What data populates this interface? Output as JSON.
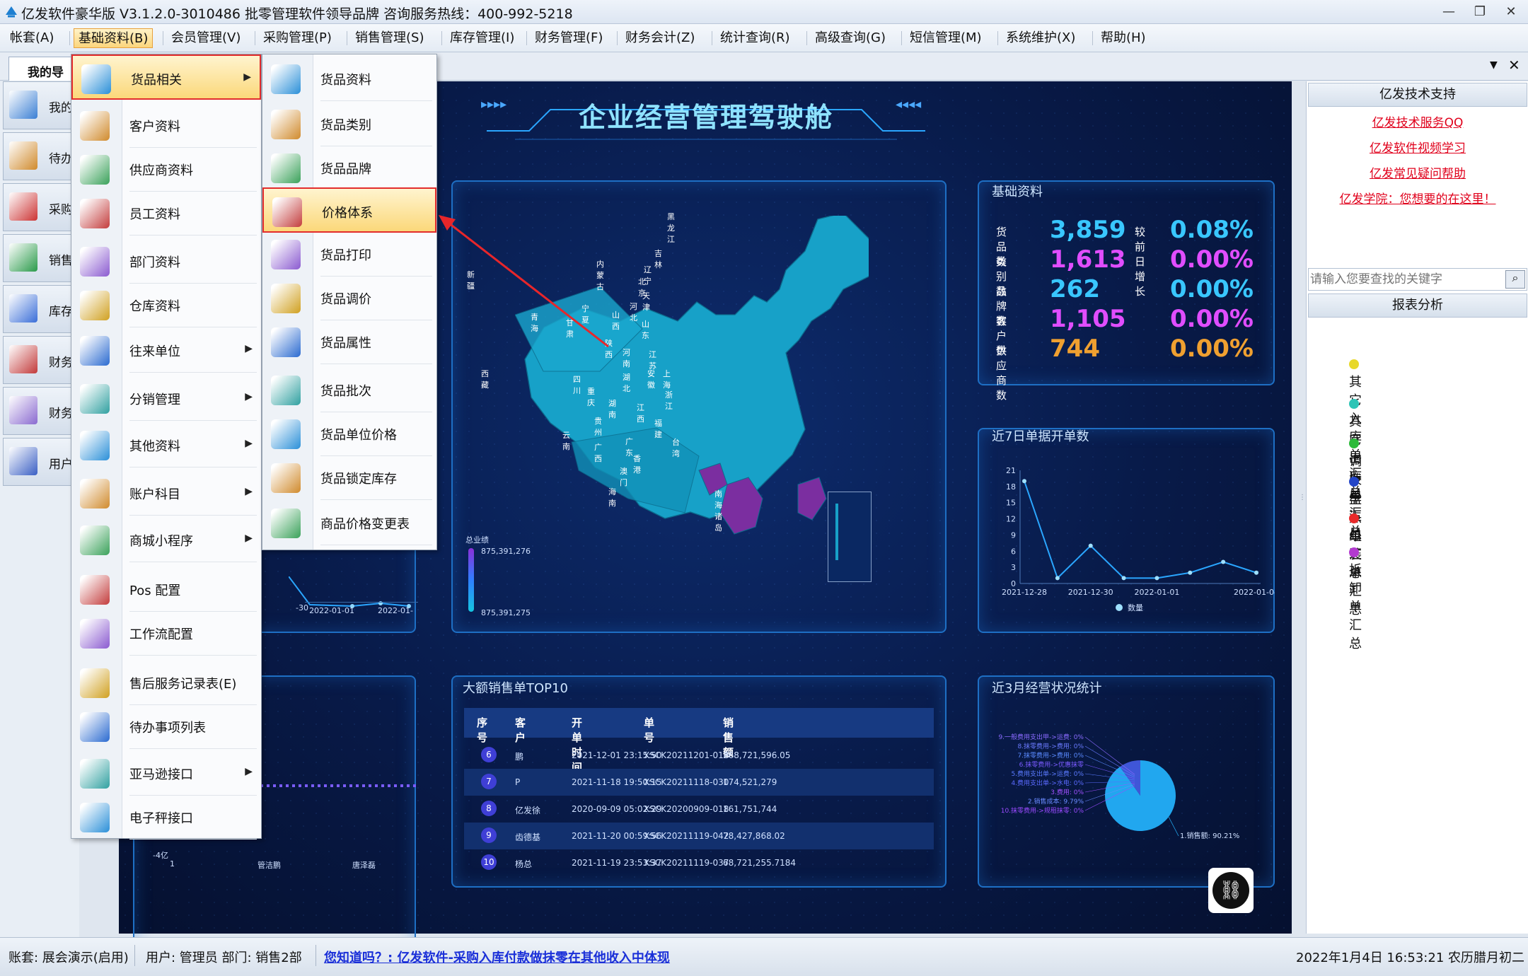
{
  "window": {
    "title": "亿发软件豪华版 V3.1.2.0-3010486 批零管理软件领导品牌 咨询服务热线：400-992-5218"
  },
  "menubar": [
    "帐套(A)",
    "基础资料(B)",
    "会员管理(V)",
    "采购管理(P)",
    "销售管理(S)",
    "库存管理(I)",
    "财务管理(F)",
    "财务会计(Z)",
    "统计查询(R)",
    "高级查询(G)",
    "短信管理(M)",
    "系统维护(X)",
    "帮助(H)"
  ],
  "tab": {
    "label": "我的导"
  },
  "leftnav": [
    "我的",
    "待办",
    "采购",
    "销售",
    "库存",
    "财务",
    "财务",
    "用户"
  ],
  "main_menu": {
    "items": [
      {
        "label": "货品相关",
        "arrow": true
      },
      {
        "label": "客户资料"
      },
      {
        "label": "供应商资料"
      },
      {
        "label": "员工资料"
      },
      {
        "label": "部门资料"
      },
      {
        "label": "仓库资料"
      },
      {
        "label": "往来单位",
        "arrow": true
      },
      {
        "label": "分销管理",
        "arrow": true
      },
      {
        "label": "其他资料",
        "arrow": true
      },
      {
        "label": "账户科目",
        "arrow": true
      },
      {
        "label": "商城小程序",
        "arrow": true
      },
      {
        "label": "Pos 配置"
      },
      {
        "label": "工作流配置"
      },
      {
        "label": "售后服务记录表(E)"
      },
      {
        "label": "待办事项列表"
      },
      {
        "label": "亚马逊接口",
        "arrow": true
      },
      {
        "label": "电子秤接口"
      }
    ]
  },
  "sub_menu": {
    "items": [
      {
        "label": "货品资料"
      },
      {
        "label": "货品类别"
      },
      {
        "label": "货品品牌"
      },
      {
        "label": "价格体系"
      },
      {
        "label": "货品打印"
      },
      {
        "label": "货品调价"
      },
      {
        "label": "货品属性"
      },
      {
        "label": "货品批次"
      },
      {
        "label": "货品单位价格"
      },
      {
        "label": "货品锁定库存"
      },
      {
        "label": "商品价格变更表"
      }
    ]
  },
  "dashboard": {
    "title": "企业经营管理驾驶舱",
    "basic": {
      "title": "基础资料",
      "growth_label": "较前日增长",
      "rows": [
        {
          "label": "货品数",
          "value": "3,859",
          "pct": "0.08%",
          "color": "#39c7ff"
        },
        {
          "label": "类别数",
          "value": "1,613",
          "pct": "0.00%",
          "color": "#e04dff"
        },
        {
          "label": "品牌数",
          "value": "262",
          "pct": "0.00%",
          "color": "#39c7ff"
        },
        {
          "label": "客户数",
          "value": "1,105",
          "pct": "0.00%",
          "color": "#e04dff"
        },
        {
          "label": "供应商数",
          "value": "744",
          "pct": "0.00%",
          "color": "#f0a030"
        }
      ]
    },
    "map_legend": {
      "label": "总业绩",
      "max": "875,391,276",
      "min": "875,391,275"
    },
    "provinces": [
      "新疆",
      "西藏",
      "青海",
      "甘肃",
      "宁夏",
      "内蒙古",
      "黑龙江",
      "吉林",
      "辽宁",
      "北京",
      "天津",
      "河北",
      "山西",
      "山东",
      "陕西",
      "河南",
      "江苏",
      "四川",
      "湖北",
      "安徽",
      "上海",
      "重庆",
      "湖南",
      "江西",
      "浙江",
      "贵州",
      "福建",
      "云南",
      "广西",
      "广东",
      "台湾",
      "香港",
      "澳门",
      "海南",
      "南海诸岛"
    ],
    "left_axis": [
      "-30",
      "2022-01-01",
      "2022-01-"
    ],
    "left_bottom": [
      "-4亿",
      "1",
      "管洁鹏",
      "唐泽磊"
    ],
    "seven_day": {
      "title": "近7日单据开单数"
    },
    "top10": {
      "title": "大额销售单TOP10",
      "headers": [
        "序号",
        "客户",
        "开单时间",
        "单号",
        "销售额"
      ],
      "rows": [
        {
          "no": "6",
          "customer": "鹏",
          "time": "2021-12-01 23:15:50",
          "order": "XSCK20211201-018",
          "amount": "268,721,596.05"
        },
        {
          "no": "7",
          "customer": "P",
          "time": "2021-11-18 19:50:15",
          "order": "XSCK20211118-030",
          "amount": "174,521,279"
        },
        {
          "no": "8",
          "customer": "亿发徐",
          "time": "2020-09-09 05:02:29",
          "order": "XSCK20200909-018",
          "amount": "161,751,744"
        },
        {
          "no": "9",
          "customer": "齿德基",
          "time": "2021-11-20 00:59:56",
          "order": "XSCK20211119-042",
          "amount": "78,427,868.02"
        },
        {
          "no": "10",
          "customer": "杨总",
          "time": "2021-11-19 23:53:37",
          "order": "XSCK20211119-037",
          "amount": "68,721,255.7184"
        }
      ]
    },
    "pie": {
      "title": "近3月经营状况统计",
      "labels": [
        "9.一般费用支出甲->运费: 0%",
        "8.抹零费用->费用: 0%",
        "7.抹零费用->费用: 0%",
        "6.抹零费用->优惠抹零",
        "5.费用支出单->运费: 0%",
        "4.费用支出单->水电: 0%",
        "3.费用: 0%",
        "2.销售成本: 9.79%",
        "10.抹零费用->规租抹零: 0%"
      ],
      "main_label": "1.销售额: 90.21%"
    }
  },
  "chart_data": [
    {
      "type": "line",
      "title": "近7日单据开单数",
      "x": [
        "2021-12-28",
        "2021-12-29",
        "2021-12-30",
        "2021-12-31",
        "2022-01-01",
        "2022-01-02",
        "2022-01-03",
        "2022-01-04"
      ],
      "values": [
        19,
        1,
        7,
        1,
        1,
        2,
        4,
        2
      ],
      "ylim": [
        0,
        21
      ],
      "yticks": [
        "21",
        "18",
        "15",
        "12",
        "9",
        "6",
        "3",
        "0"
      ],
      "xticks": [
        "2021-12-28",
        "2021-12-30",
        "2022-01-01",
        "2022-01-04"
      ],
      "legend": "数量",
      "grid": false
    },
    {
      "type": "pie",
      "title": "近3月经营状况统计",
      "series": [
        {
          "name": "1.销售额",
          "values": [
            90.21
          ]
        },
        {
          "name": "2.销售成本",
          "values": [
            9.79
          ]
        }
      ]
    }
  ],
  "right": {
    "support_title": "亿发技术支持",
    "links": [
      "亿发技术服务QQ",
      "亿发软件视频学习",
      "亿发常见疑问帮助",
      "亿发学院：您想要的在这里！"
    ],
    "search_placeholder": "请输入您要查找的关键字",
    "report_title": "报表分析",
    "reports": [
      {
        "label": "其它入库单汇总",
        "color": "#e8d82a"
      },
      {
        "label": "其它出库单汇总",
        "color": "#2ec4b6"
      },
      {
        "label": "调拨单汇总",
        "color": "#2cba3a"
      },
      {
        "label": "盘点单汇总",
        "color": "#2446c8"
      },
      {
        "label": "组装单汇总",
        "color": "#e82a2a"
      },
      {
        "label": "拆卸单汇总",
        "color": "#b33ad0"
      }
    ]
  },
  "status": {
    "account": "账套: 展会演示(启用)",
    "user": "用户: 管理员  部门: 销售2部",
    "tip": "您知道吗？: 亿发软件-采购入库付款做抹零在其他收入中体现",
    "datetime": "2022年1月4日 16:53:21 农历腊月初二"
  }
}
